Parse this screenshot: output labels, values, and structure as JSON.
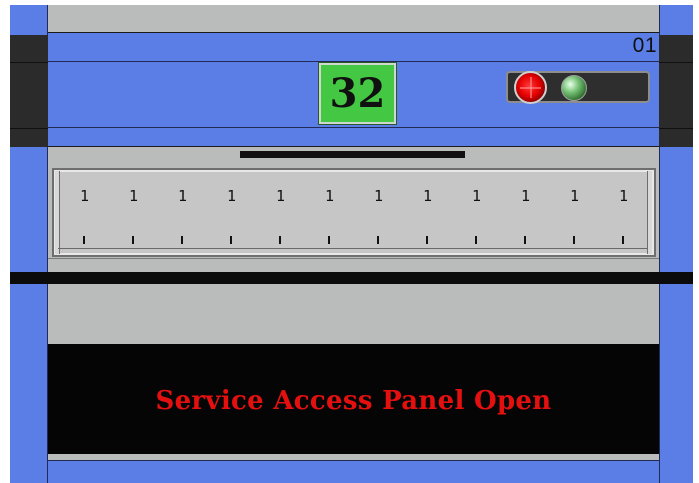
{
  "unit": {
    "label": "01"
  },
  "counter": {
    "value": "32"
  },
  "indicators": [
    {
      "name": "red-status-light",
      "color": "#e60000",
      "state": "on"
    },
    {
      "name": "green-status-light",
      "color": "#2f6f2f",
      "state": "off"
    }
  ],
  "ruler": {
    "top_tick_glyph": "1",
    "tick_count": 12
  },
  "message": {
    "text": "Service Access Panel Open",
    "color": "#e41010"
  },
  "colors": {
    "frame_blue": "#5b7ee6",
    "panel_grey": "#b9bcbb",
    "counter_green": "#44c742",
    "message_bg": "#050505"
  }
}
